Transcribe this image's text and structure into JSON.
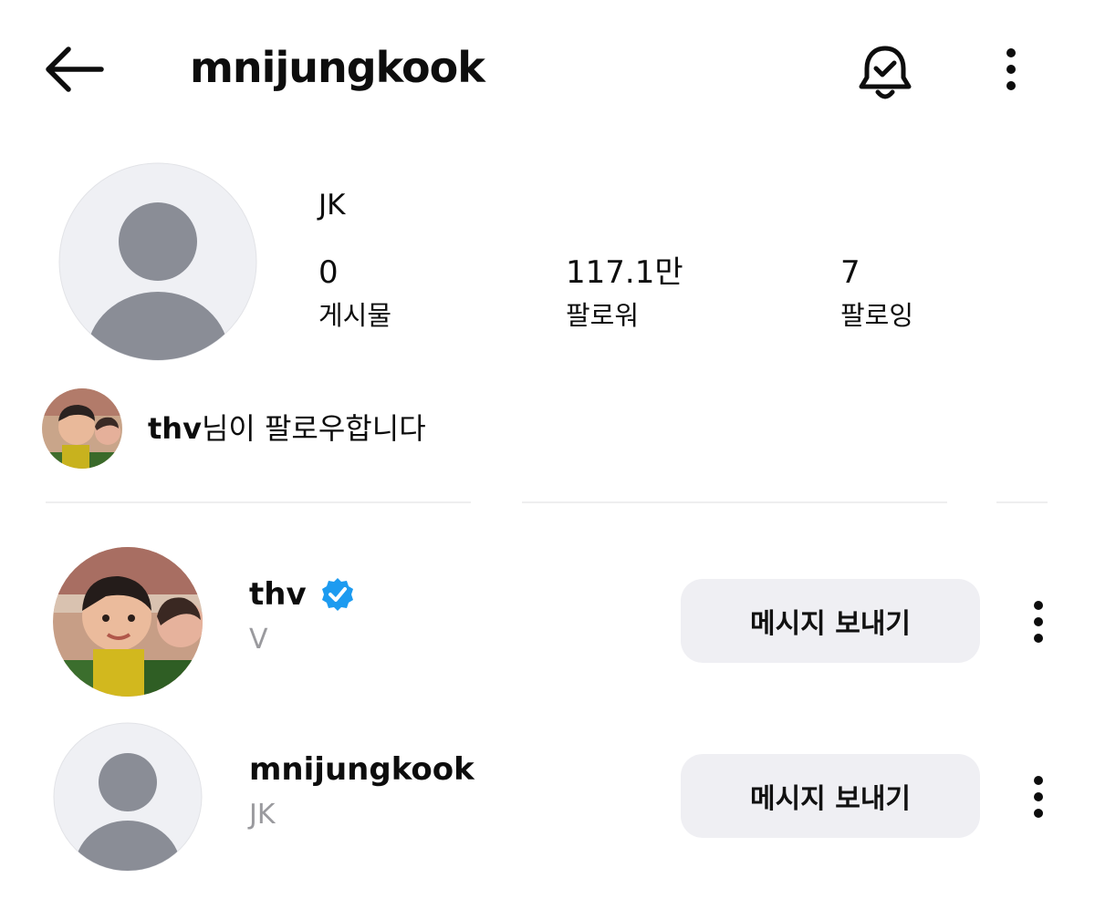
{
  "header": {
    "username": "mnijungkook",
    "back_icon": "arrow-left-icon",
    "bell_icon": "bell-check-icon",
    "menu_icon": "more-vertical-icon"
  },
  "profile": {
    "display_name": "JK",
    "stats": [
      {
        "value": "0",
        "label": "게시물"
      },
      {
        "value": "117.1만",
        "label": "팔로워"
      },
      {
        "value": "7",
        "label": "팔로잉"
      }
    ]
  },
  "mutual": {
    "username": "thv",
    "suffix": "님이 팔로우합니다"
  },
  "list": [
    {
      "username": "thv",
      "name": "V",
      "verified": true,
      "button": "메시지 보내기"
    },
    {
      "username": "mnijungkook",
      "name": "JK",
      "verified": false,
      "button": "메시지 보내기"
    }
  ],
  "colors": {
    "verified": "#1d9bf0",
    "button_bg": "#efeff3",
    "secondary_text": "#9a9a9e",
    "default_avatar_bg": "#eff0f4",
    "default_avatar_fg": "#8a8d96"
  }
}
